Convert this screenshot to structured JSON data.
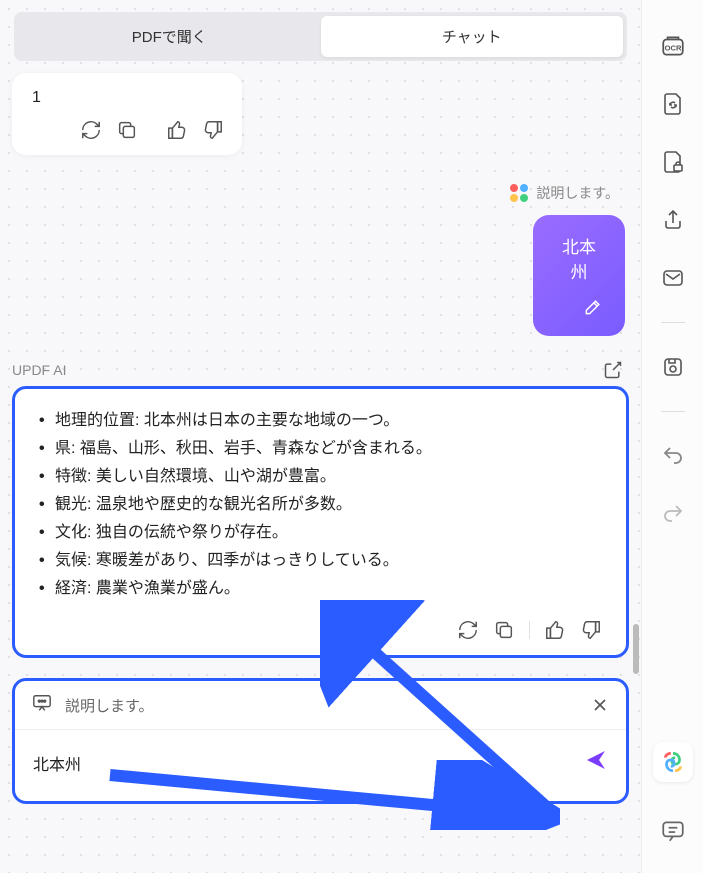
{
  "tabs": {
    "pdf": "PDFで聞く",
    "chat": "チャット"
  },
  "first_message": {
    "text": "1"
  },
  "status_label": "説明します。",
  "user_bubble": {
    "text": "北本州"
  },
  "sender_label": "UPDF AI",
  "response": {
    "items": [
      "地理的位置: 北本州は日本の主要な地域の一つ。",
      "県: 福島、山形、秋田、岩手、青森などが含まれる。",
      "特徴: 美しい自然環境、山や湖が豊富。",
      "観光: 温泉地や歴史的な観光名所が多数。",
      "文化: 独自の伝統や祭りが存在。",
      "気候: 寒暖差があり、四季がはっきりしている。",
      "経済: 農業や漁業が盛ん。"
    ]
  },
  "input": {
    "header_label": "説明します。",
    "value": "北本州"
  }
}
